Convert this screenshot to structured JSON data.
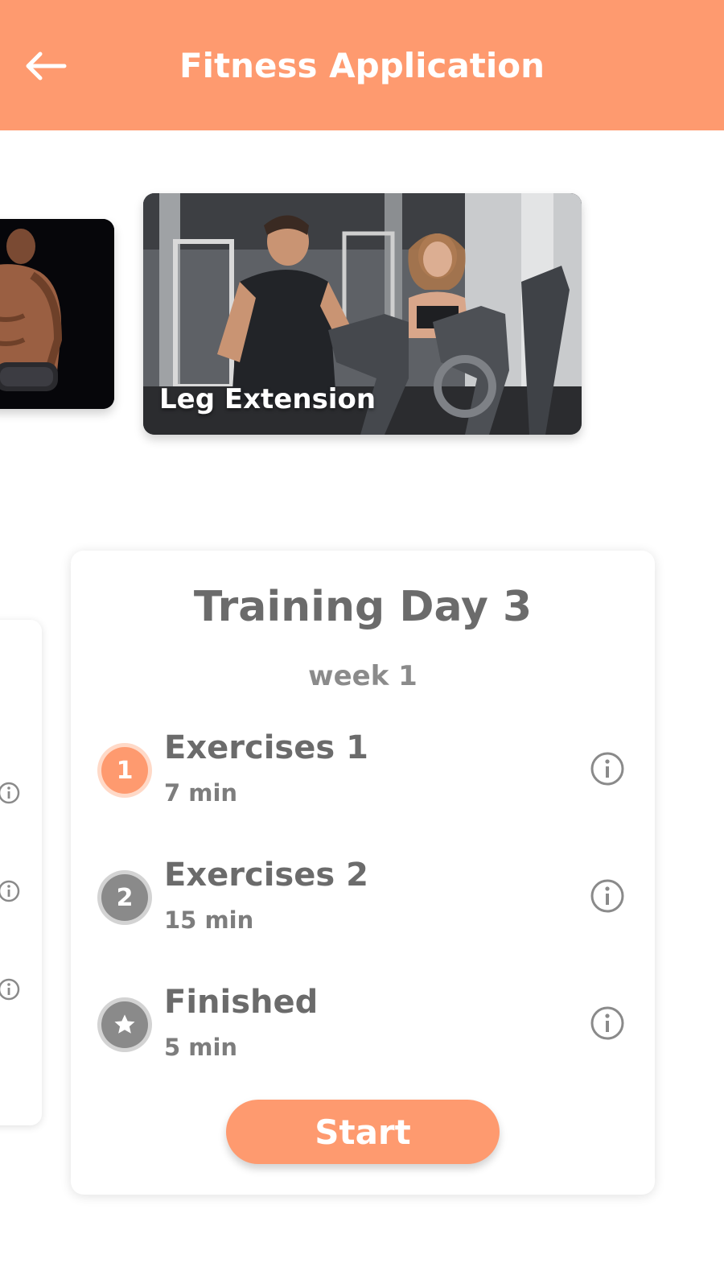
{
  "header": {
    "title": "Fitness Application",
    "back_icon": "arrow-left-icon"
  },
  "carousel": {
    "items": [
      {
        "label": "",
        "image": "bodybuilder-with-dumbbell-photo"
      },
      {
        "label": "Leg Extension",
        "image": "gym-exercise-bikes-photo"
      }
    ]
  },
  "training": {
    "title": "Training Day 3",
    "subtitle": "week 1",
    "steps": [
      {
        "badge": "1",
        "name": "Exercises 1",
        "duration": "7 min",
        "state": "active",
        "info_icon": "info-icon"
      },
      {
        "badge": "2",
        "name": "Exercises 2",
        "duration": "15 min",
        "state": "pending",
        "info_icon": "info-icon"
      },
      {
        "badge": "star-icon",
        "name": "Finished",
        "duration": "5 min",
        "state": "pending",
        "info_icon": "info-icon"
      }
    ],
    "start_label": "Start"
  },
  "colors": {
    "accent": "#fe9a6f",
    "accent_light": "#ffd9c7",
    "text_dark": "#6b6b6b",
    "badge_grey": "#8a8a8a"
  }
}
